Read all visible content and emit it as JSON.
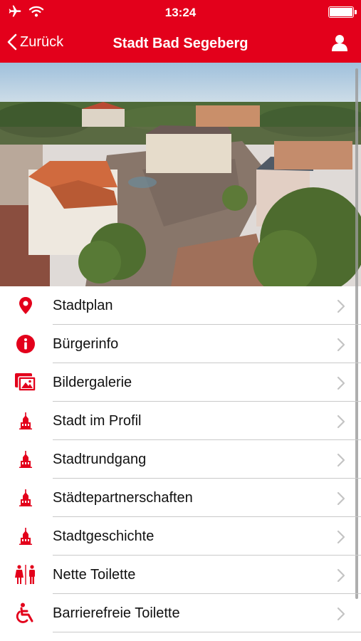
{
  "status": {
    "time": "13:24"
  },
  "nav": {
    "back_label": "Zurück",
    "title": "Stadt Bad Segeberg"
  },
  "accent_color": "#e3001b",
  "menu": [
    {
      "label": "Stadtplan",
      "icon": "map-pin-icon"
    },
    {
      "label": "Bürgerinfo",
      "icon": "info-icon"
    },
    {
      "label": "Bildergalerie",
      "icon": "gallery-icon"
    },
    {
      "label": "Stadt im Profil",
      "icon": "town-hall-icon"
    },
    {
      "label": "Stadtrundgang",
      "icon": "town-hall-icon"
    },
    {
      "label": "Städtepartnerschaften",
      "icon": "town-hall-icon"
    },
    {
      "label": "Stadtgeschichte",
      "icon": "town-hall-icon"
    },
    {
      "label": "Nette Toilette",
      "icon": "toilet-icon"
    },
    {
      "label": "Barrierefreie Toilette",
      "icon": "wheelchair-icon"
    }
  ]
}
